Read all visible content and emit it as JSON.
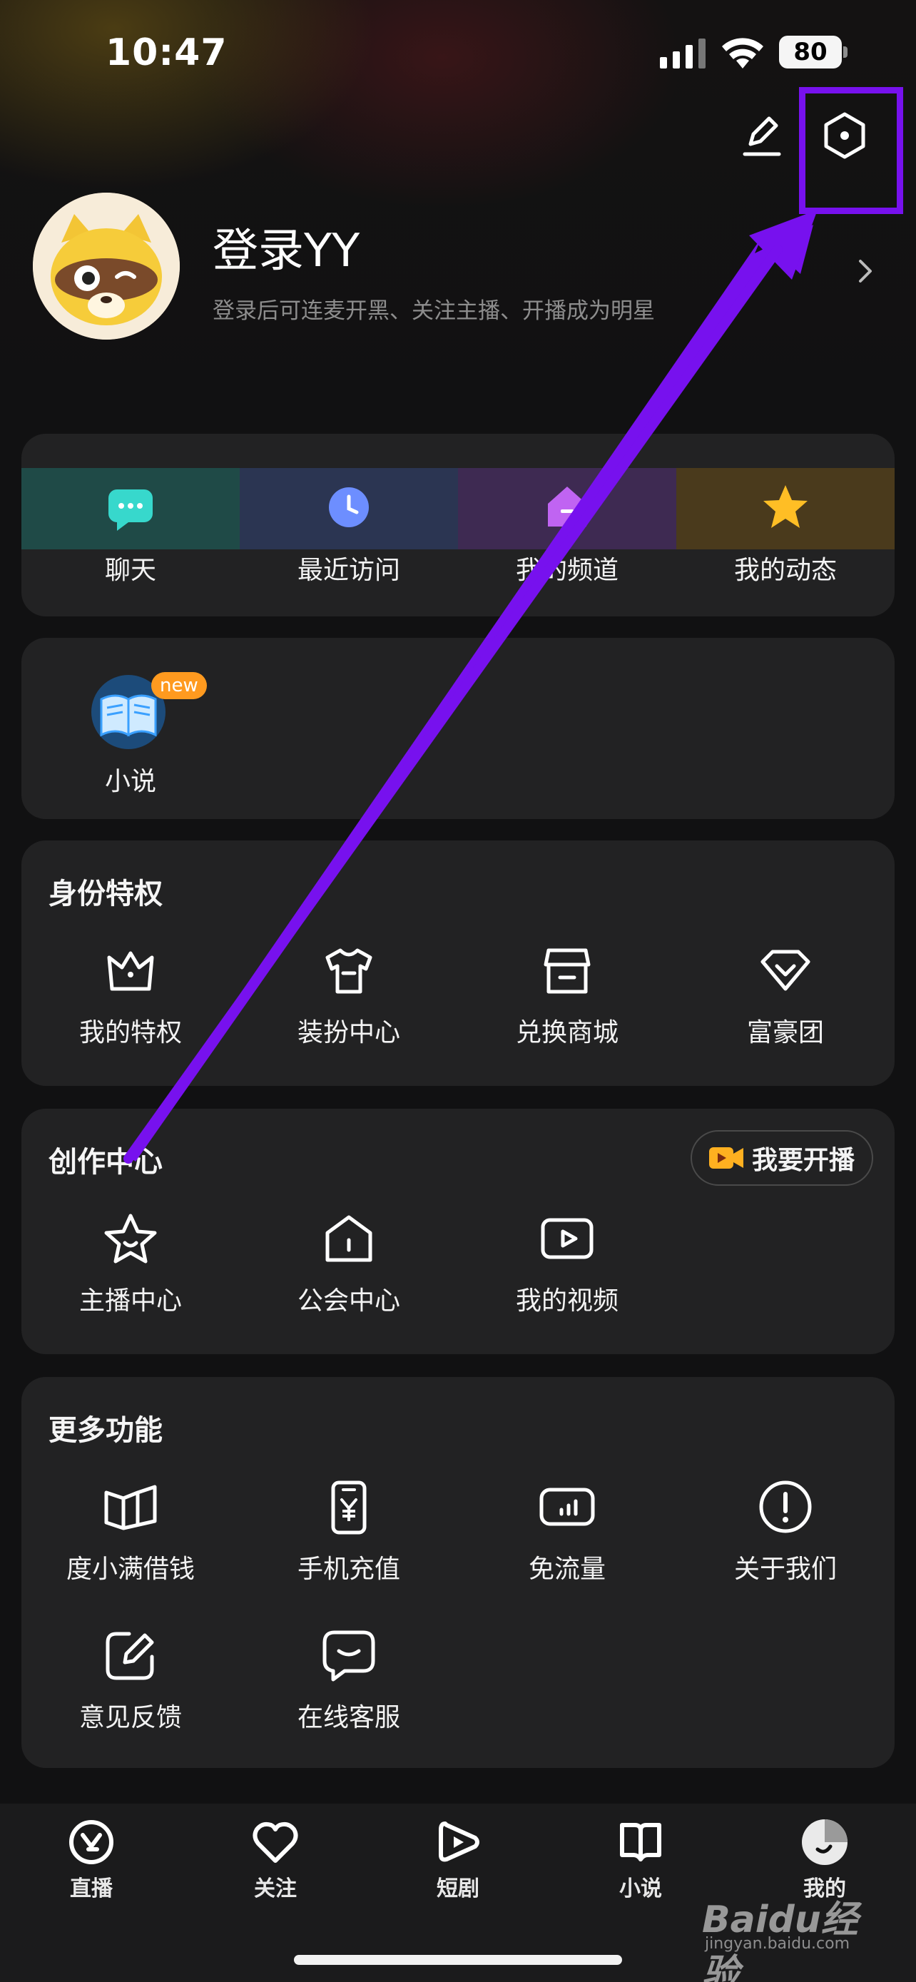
{
  "status_bar": {
    "time": "10:47",
    "battery": "80"
  },
  "profile": {
    "title": "登录YY",
    "subtitle": "登录后可连麦开黑、关注主播、开播成为明星"
  },
  "quick_actions": [
    {
      "label": "聊天",
      "icon": "chat-bubble-icon",
      "color": "#2fd3c8"
    },
    {
      "label": "最近访问",
      "icon": "clock-icon",
      "color": "#6a8cff"
    },
    {
      "label": "我的频道",
      "icon": "house-icon",
      "color": "#b65cf0"
    },
    {
      "label": "我的动态",
      "icon": "star-icon",
      "color": "#ffbb22"
    }
  ],
  "novel_card": {
    "label": "小说",
    "badge": "new",
    "icon": "book-icon"
  },
  "privilege": {
    "title": "身份特权",
    "items": [
      {
        "label": "我的特权",
        "icon": "crown-icon"
      },
      {
        "label": "装扮中心",
        "icon": "shirt-icon"
      },
      {
        "label": "兑换商城",
        "icon": "store-icon"
      },
      {
        "label": "富豪团",
        "icon": "diamond-icon"
      }
    ]
  },
  "creator": {
    "title": "创作中心",
    "live_button": "我要开播",
    "items": [
      {
        "label": "主播中心",
        "icon": "smile-star-icon"
      },
      {
        "label": "公会中心",
        "icon": "guild-house-icon"
      },
      {
        "label": "我的视频",
        "icon": "video-play-icon"
      }
    ]
  },
  "more": {
    "title": "更多功能",
    "items": [
      {
        "label": "度小满借钱",
        "icon": "open-book-icon"
      },
      {
        "label": "手机充值",
        "icon": "phone-yuan-icon"
      },
      {
        "label": "免流量",
        "icon": "data-chart-icon"
      },
      {
        "label": "关于我们",
        "icon": "info-exclamation-icon"
      },
      {
        "label": "意见反馈",
        "icon": "edit-square-icon"
      },
      {
        "label": "在线客服",
        "icon": "chat-service-icon"
      }
    ]
  },
  "tabbar": [
    {
      "label": "直播",
      "icon": "live-y-icon"
    },
    {
      "label": "关注",
      "icon": "heart-icon"
    },
    {
      "label": "短剧",
      "icon": "play-icon"
    },
    {
      "label": "小说",
      "icon": "book-tab-icon"
    },
    {
      "label": "我的",
      "icon": "profile-tab-icon"
    }
  ],
  "watermark": {
    "logo": "Baidu经验",
    "site": "jingyan.baidu.com"
  },
  "colors": {
    "accent_purple": "#7711ee",
    "card_bg": "#222223",
    "page_bg": "#111112",
    "badge_orange": "#ff9a1f"
  }
}
